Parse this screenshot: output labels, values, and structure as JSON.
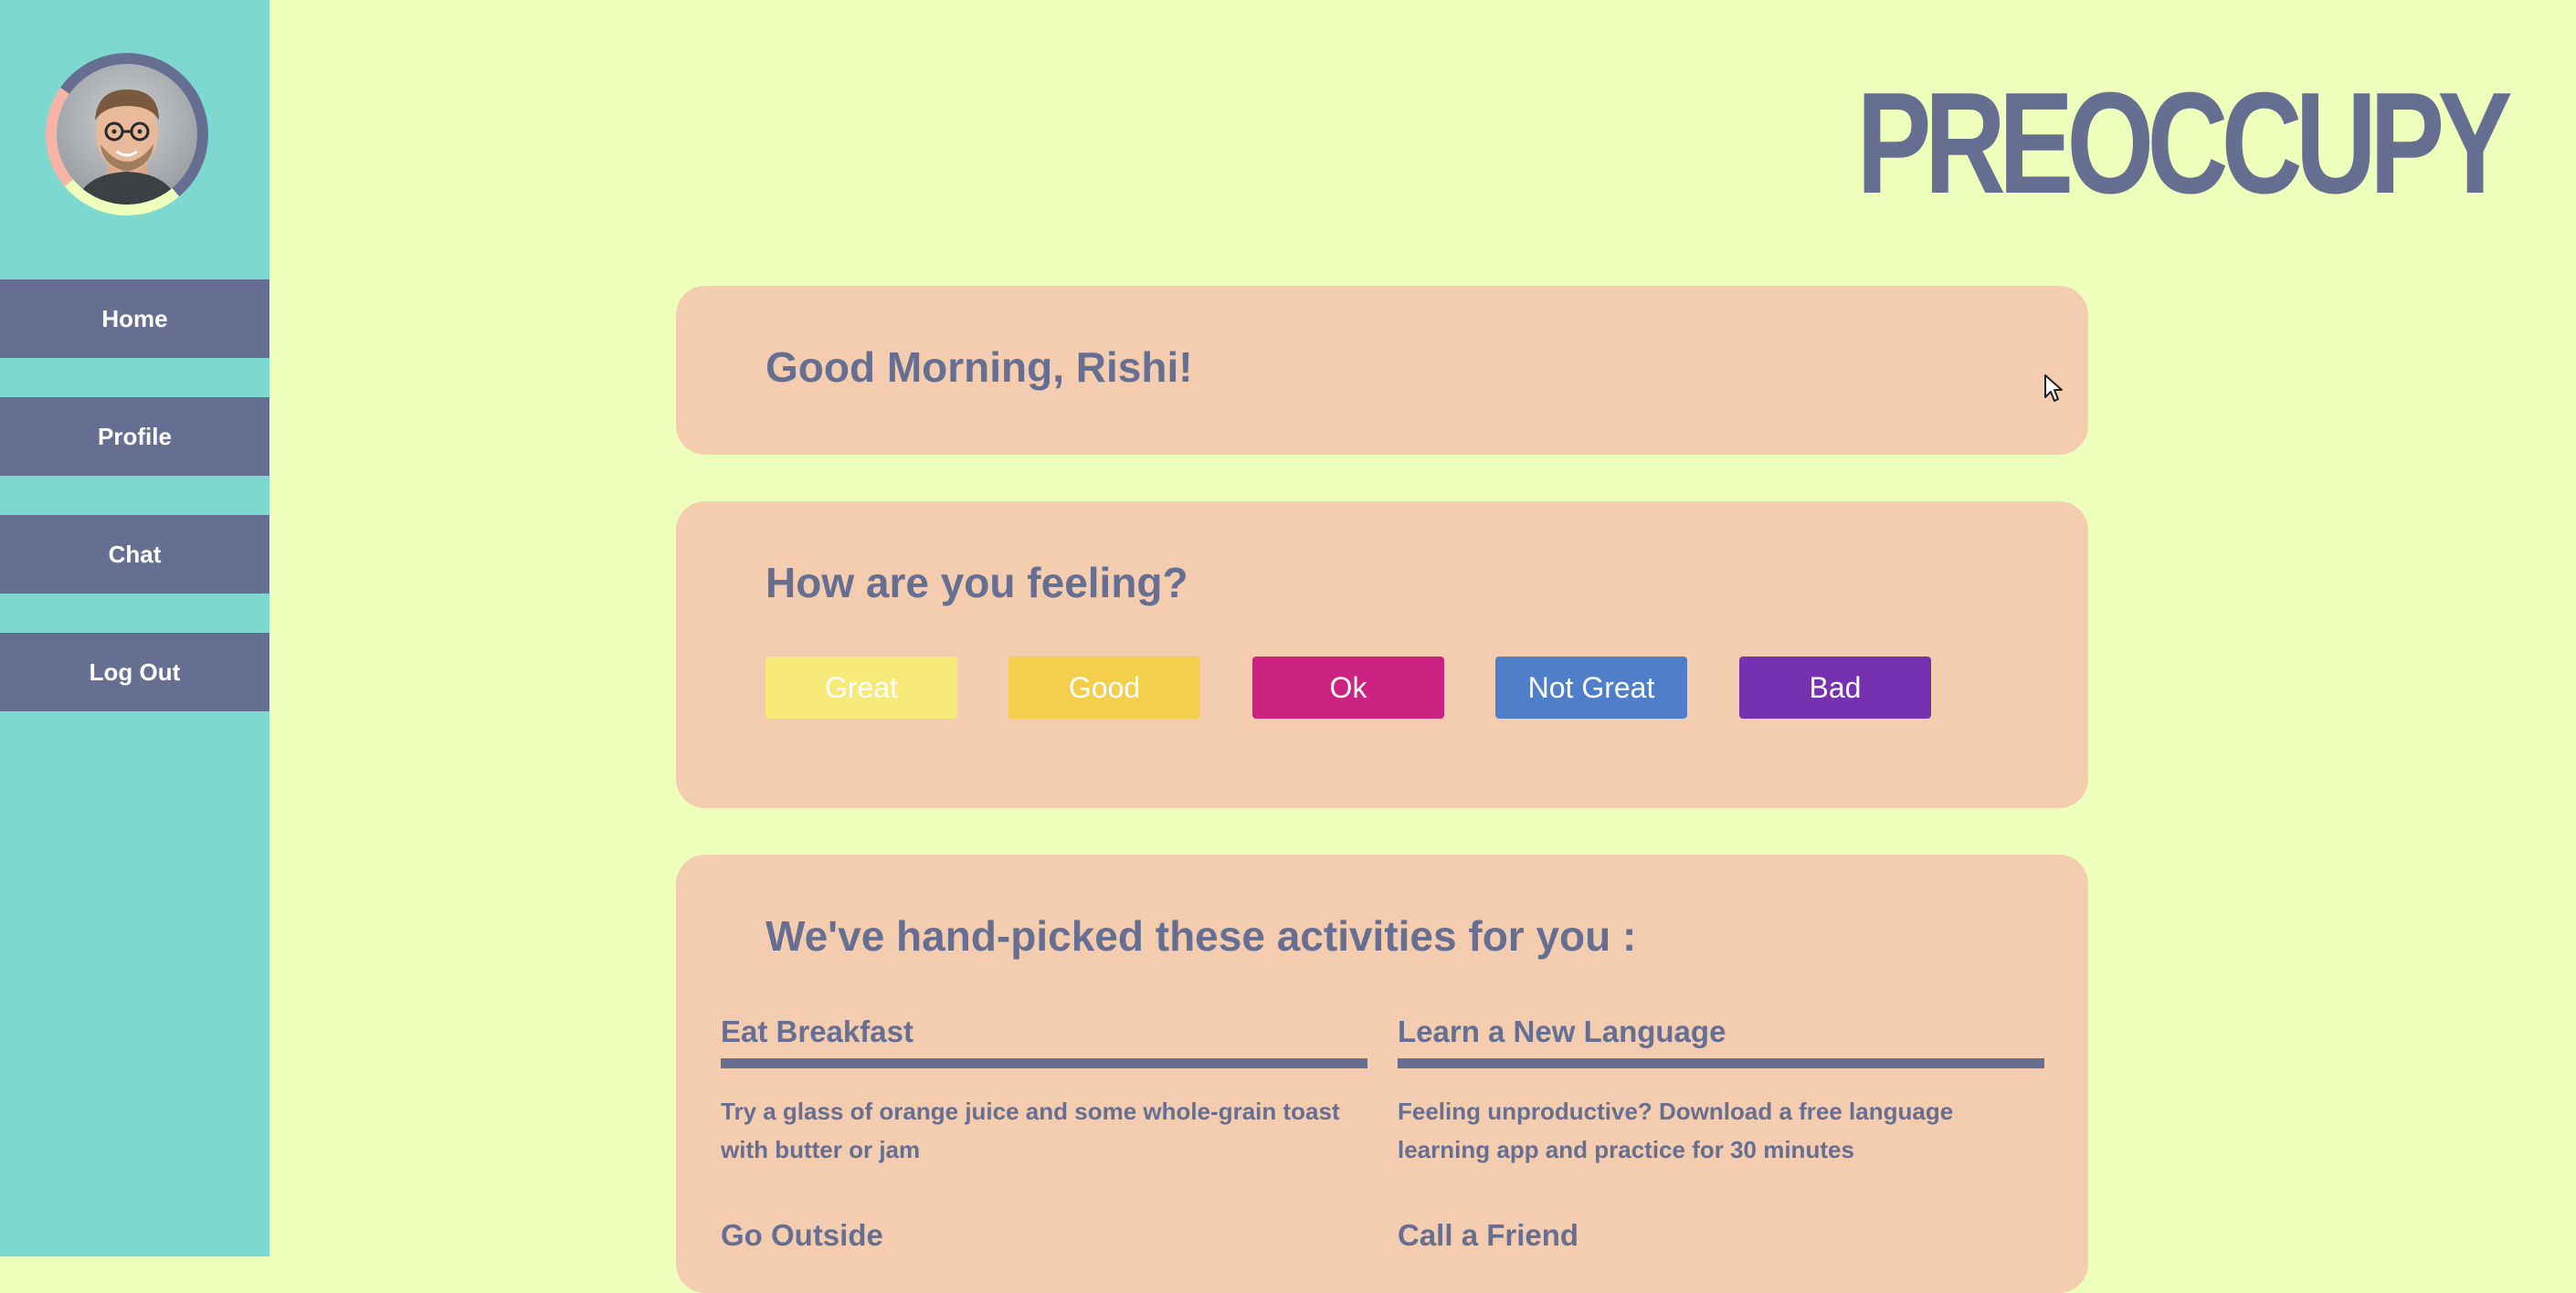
{
  "sidebar": {
    "avatar_icon": "user-avatar",
    "nav": [
      {
        "label": "Home"
      },
      {
        "label": "Profile"
      },
      {
        "label": "Chat"
      },
      {
        "label": "Log Out"
      }
    ]
  },
  "header": {
    "logo": "PREOCCUPY"
  },
  "greeting": {
    "text": "Good Morning, Rishi!"
  },
  "mood": {
    "question": "How are you feeling?",
    "options": [
      {
        "label": "Great",
        "color": "#f7ea7a"
      },
      {
        "label": "Good",
        "color": "#f5cf4c"
      },
      {
        "label": "Ok",
        "color": "#cc2282"
      },
      {
        "label": "Not Great",
        "color": "#4f7fc8"
      },
      {
        "label": "Bad",
        "color": "#7531b0"
      }
    ]
  },
  "activities": {
    "heading": "We've hand-picked these activities for you :",
    "items": [
      {
        "title": "Eat Breakfast",
        "description": "Try a glass of orange juice and some whole-grain toast with butter or jam"
      },
      {
        "title": "Learn a New Language",
        "description": "Feeling unproductive? Download a free language learning app and practice for 30 minutes"
      },
      {
        "title": "Go Outside",
        "description": ""
      },
      {
        "title": "Call a Friend",
        "description": ""
      }
    ]
  },
  "colors": {
    "background": "#eeffbb",
    "sidebar": "#7dd9cf",
    "accent": "#666e91",
    "card": "#f4cdb0"
  }
}
